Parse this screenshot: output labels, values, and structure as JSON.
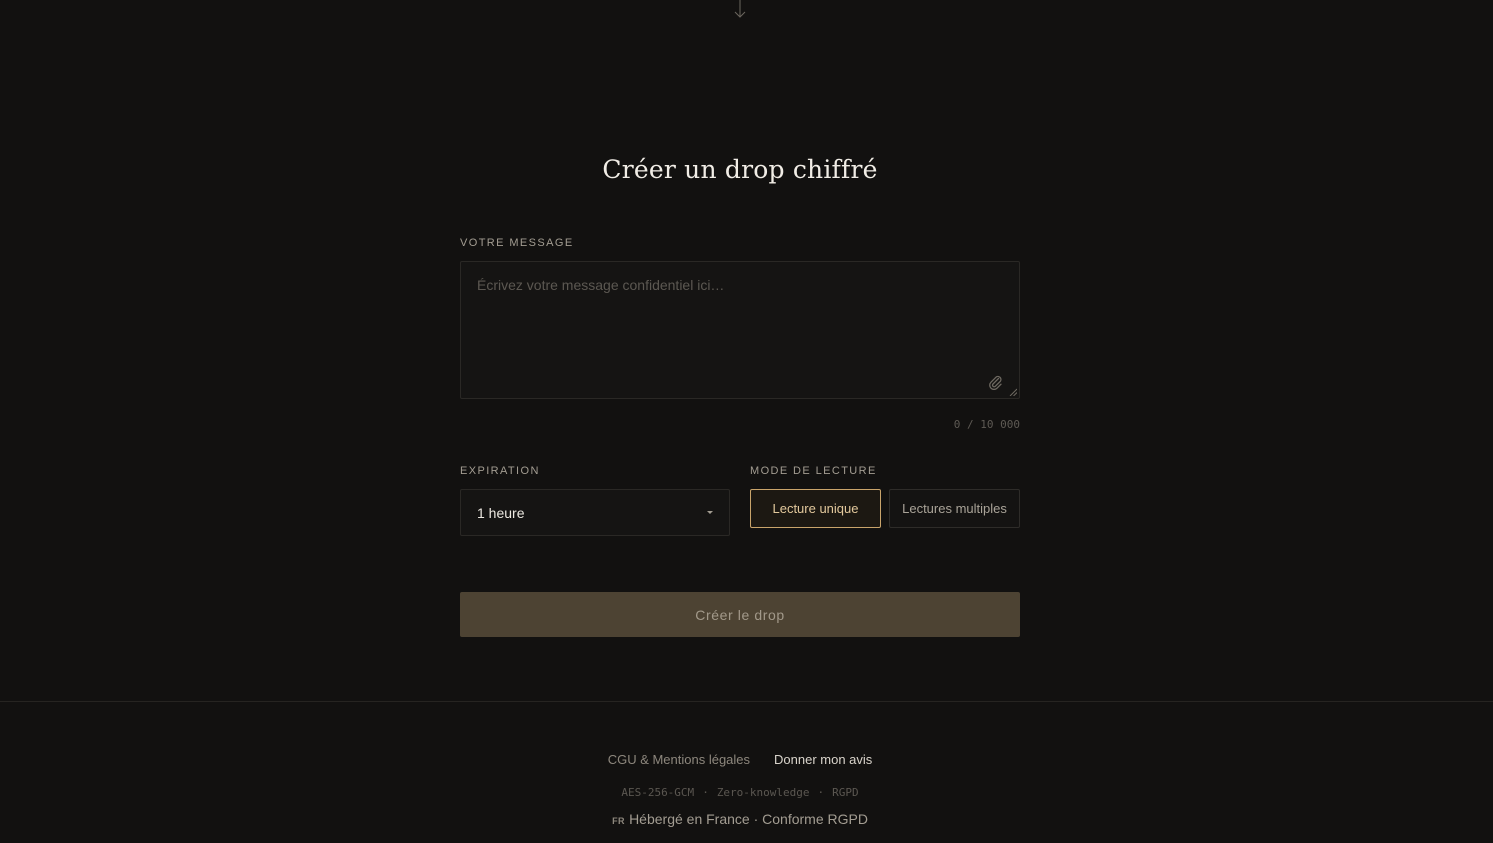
{
  "title": "Créer un drop chiffré",
  "message": {
    "label": "Votre message",
    "placeholder": "Écrivez votre message confidentiel ici…",
    "value": "",
    "counter": "0 / 10 000"
  },
  "expiration": {
    "label": "Expiration",
    "selected": "1 heure"
  },
  "read_mode": {
    "label": "Mode de lecture",
    "options": [
      {
        "label": "Lecture unique",
        "active": true
      },
      {
        "label": "Lectures multiples",
        "active": false
      }
    ]
  },
  "submit_label": "Créer le drop",
  "footer": {
    "links": {
      "legal": "CGU & Mentions légales",
      "feedback": "Donner mon avis"
    },
    "tech": [
      "AES-256-GCM",
      "Zero-knowledge",
      "RGPD"
    ],
    "tech_separator": "·",
    "host_flag": "FR",
    "host_text": "Hébergé en France · Conforme RGPD"
  },
  "colors": {
    "background": "#121110",
    "accent": "#c9a46b",
    "submit_bg": "#4d4333"
  }
}
